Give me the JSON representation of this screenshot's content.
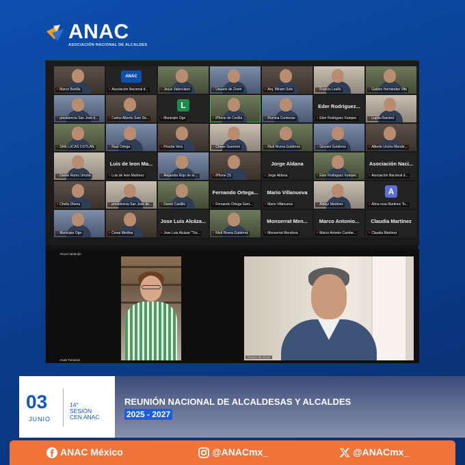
{
  "brand": {
    "name": "ANAC",
    "subtitle": "ASOCIACIÓN NACIONAL DE ALCALDES",
    "colors": {
      "primary_blue": "#0d4fae",
      "accent_orange": "#f1733a",
      "logo_orange": "#f39b21",
      "logo_blue": "#2a6fd6"
    }
  },
  "zoom": {
    "speaking_hint": "Ahora hablando",
    "gallery_rows": [
      [
        {
          "label": "Marco Bonilla",
          "kind": "video"
        },
        {
          "label": "Asociación Nacional d...",
          "kind": "logo"
        },
        {
          "label": "Jesus Valenciano",
          "kind": "video"
        },
        {
          "label": "Usuario de Zoom",
          "kind": "video"
        },
        {
          "label": "Arq. Miriam Soto",
          "kind": "video"
        },
        {
          "label": "Francis Leaño",
          "kind": "video"
        },
        {
          "label": "Gabino Hernández Vite",
          "kind": "video"
        }
      ],
      [
        {
          "label": "presidencia San Jose d...",
          "kind": "video"
        },
        {
          "label": "Carlos Alberto Soto De...",
          "kind": "video"
        },
        {
          "label": "Municipio Ogo",
          "kind": "letter",
          "letter": "L",
          "letter_color": "#1e8a4c"
        },
        {
          "label": "iPhone de Cecilia",
          "kind": "video",
          "active": true
        },
        {
          "label": "Romina Contreras",
          "kind": "video"
        },
        {
          "label": "Eder Rodriguez Xutepec",
          "kind": "name",
          "big": "Eder Rodriguez..."
        },
        {
          "label": "Lupita Ramirez",
          "kind": "video"
        }
      ],
      [
        {
          "label": "SAN LUCAS OJITLAN",
          "kind": "video"
        },
        {
          "label": "Raul Ortega",
          "kind": "video"
        },
        {
          "label": "Priscila Vera",
          "kind": "video"
        },
        {
          "label": "Chepe Guerrero",
          "kind": "video"
        },
        {
          "label": "Riult Rivera Gutiérrez",
          "kind": "video"
        },
        {
          "label": "Giovani Gutiérrez",
          "kind": "video"
        },
        {
          "label": "Alberto Urcino Mende...",
          "kind": "video"
        }
      ],
      [
        {
          "label": "Daniel Romo Urrutia",
          "kind": "video"
        },
        {
          "label": "Luis de leon Martinez",
          "kind": "name",
          "big": "Luis de leon Ma..."
        },
        {
          "label": "Alejandra Rojo de la ...",
          "kind": "video"
        },
        {
          "label": "iPhone (5)",
          "kind": "video"
        },
        {
          "label": "Jorge Aldana",
          "kind": "name",
          "big": "Jorge Aldana"
        },
        {
          "label": "Eder Rodriguez Xutepec",
          "kind": "video"
        },
        {
          "label": "Asociación Nacional d...",
          "kind": "name",
          "big": "Asociación Naci..."
        }
      ],
      [
        {
          "label": "Chelis Olvera",
          "kind": "video"
        },
        {
          "label": "presidencia San Jose de...",
          "kind": "video"
        },
        {
          "label": "Daniel Castillo",
          "kind": "video"
        },
        {
          "label": "Fernando Ortega Sant...",
          "kind": "name",
          "big": "Fernando Ortega..."
        },
        {
          "label": "Mario Villanueva",
          "kind": "name",
          "big": "Mario Villanueva"
        },
        {
          "label": "Aldayr Martinez",
          "kind": "video"
        },
        {
          "label": "Alma rosa Martinez To...",
          "kind": "letter",
          "letter": "A",
          "letter_color": "#5a6fd6"
        }
      ],
      [
        {
          "label": "Municipio Ogo",
          "kind": "video"
        },
        {
          "label": "Cesar Medina",
          "kind": "video"
        },
        {
          "label": "Jose Luis Alcázar \"Toc...",
          "kind": "name",
          "big": "Jose Luis Alcáza..."
        },
        {
          "label": "Riult Rivera Gutiérrez",
          "kind": "video"
        },
        {
          "label": "Monserrat Mendoza",
          "kind": "name",
          "big": "Monserrat Men..."
        },
        {
          "label": "Marco Antonio Cambe...",
          "kind": "name",
          "big": "Marco Antonio..."
        },
        {
          "label": "Claudia Martinez",
          "kind": "name",
          "big": "Claudia Martinez"
        }
      ]
    ],
    "speaker_left_name": "Anais Tomasini",
    "speaker_right_name": "Usuario de Zoom"
  },
  "event": {
    "day": "03",
    "month": "JUNIO",
    "session_lines": [
      "14°",
      "SESIÓN",
      "CEN ANAC"
    ],
    "title": "REUNIÓN NACIONAL DE ALCALDESAS Y ALCALDES",
    "years": "2025 - 2027"
  },
  "footer": {
    "facebook": "ANAC México",
    "instagram": "@ANACmx_",
    "x": "@ANACmx_"
  }
}
